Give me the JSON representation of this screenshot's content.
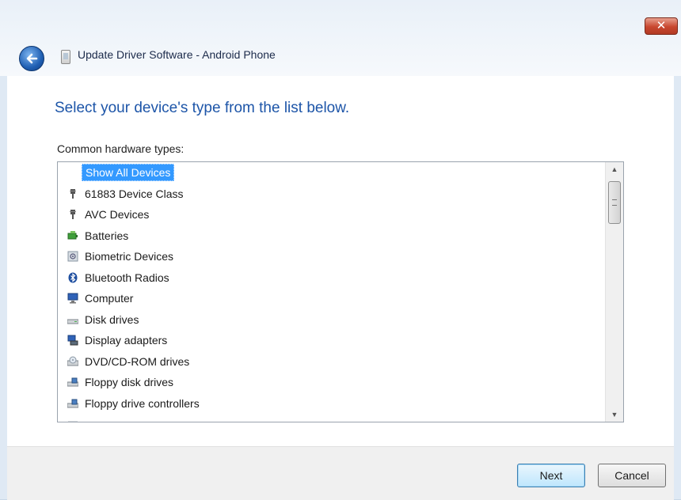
{
  "window": {
    "title": "Update Driver Software - Android Phone",
    "close_label": "✕"
  },
  "main": {
    "heading": "Select your device's type from the list below.",
    "list_label": "Common hardware types:",
    "items": [
      {
        "label": "Show All Devices",
        "icon": "none",
        "selected": true
      },
      {
        "label": "61883 Device Class",
        "icon": "plug-icon"
      },
      {
        "label": "AVC Devices",
        "icon": "plug-icon"
      },
      {
        "label": "Batteries",
        "icon": "battery-icon"
      },
      {
        "label": "Biometric Devices",
        "icon": "fingerprint-icon"
      },
      {
        "label": "Bluetooth Radios",
        "icon": "bluetooth-icon"
      },
      {
        "label": "Computer",
        "icon": "computer-icon"
      },
      {
        "label": "Disk drives",
        "icon": "disk-drive-icon"
      },
      {
        "label": "Display adapters",
        "icon": "display-adapter-icon"
      },
      {
        "label": "DVD/CD-ROM drives",
        "icon": "dvd-drive-icon"
      },
      {
        "label": "Floppy disk drives",
        "icon": "floppy-drive-icon"
      },
      {
        "label": "Floppy drive controllers",
        "icon": "floppy-controller-icon"
      }
    ]
  },
  "footer": {
    "next_label": "Next",
    "cancel_label": "Cancel"
  }
}
